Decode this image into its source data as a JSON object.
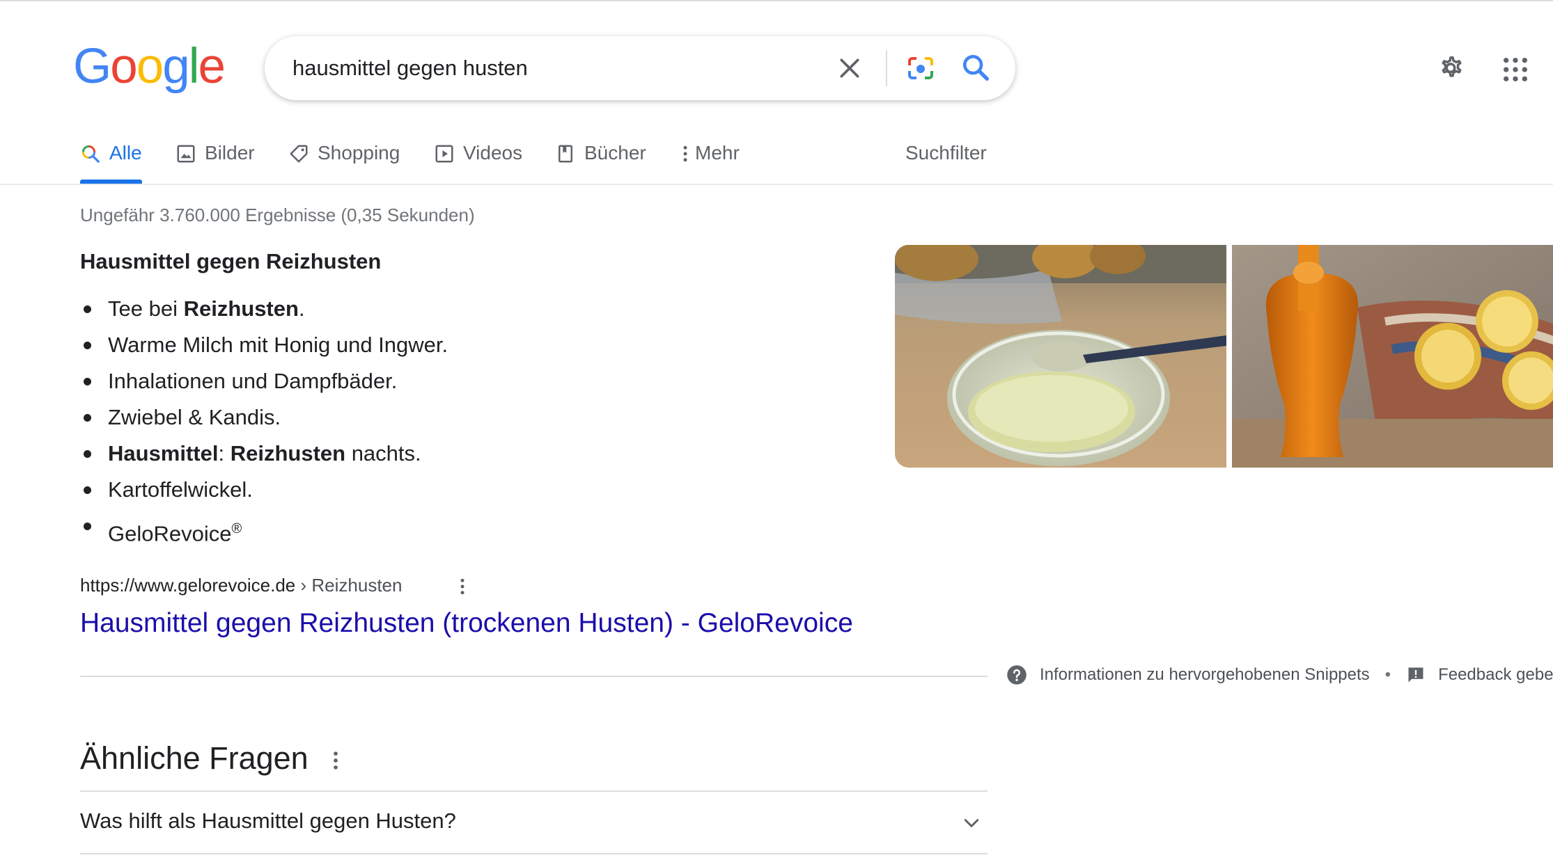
{
  "logo": {
    "letters": [
      "G",
      "o",
      "o",
      "g",
      "l",
      "e"
    ],
    "colors": [
      "#4285F4",
      "#EA4335",
      "#FBBC05",
      "#4285F4",
      "#34A853",
      "#EA4335"
    ]
  },
  "search": {
    "query": "hausmittel gegen husten"
  },
  "icons": {
    "clear": "close-icon",
    "camera": "lens-camera-icon",
    "search": "search-icon",
    "settings": "gear-icon",
    "apps": "apps-grid-icon"
  },
  "tabs": [
    {
      "label": "Alle",
      "icon": "search-icon",
      "active": true
    },
    {
      "label": "Bilder",
      "icon": "image-icon"
    },
    {
      "label": "Shopping",
      "icon": "tag-icon"
    },
    {
      "label": "Videos",
      "icon": "play-icon"
    },
    {
      "label": "Bücher",
      "icon": "book-icon"
    },
    {
      "label": "Mehr",
      "icon": "more-vert-icon"
    }
  ],
  "search_tools": "Suchfilter",
  "stats": "Ungefähr 3.760.000 Ergebnisse (0,35 Sekunden)",
  "snippet": {
    "title": "Hausmittel gegen Reizhusten",
    "items": [
      {
        "pre": "Tee bei ",
        "bold": "Reizhusten",
        "post": "."
      },
      {
        "text": "Warme Milch mit Honig und Ingwer."
      },
      {
        "text": "Inhalationen und Dampfbäder."
      },
      {
        "text": "Zwiebel & Kandis."
      },
      {
        "bold1": "Hausmittel",
        "sep": ": ",
        "bold2": "Reizhusten",
        "post": " nachts."
      },
      {
        "text": "Kartoffelwickel."
      },
      {
        "text": "GeloRevoice",
        "sup": "®"
      }
    ]
  },
  "result": {
    "url": "https://www.gelorevoice.de",
    "breadcrumb": " › Reizhusten",
    "title": "Hausmittel gegen Reizhusten (trockenen Husten) - GeloRevoice"
  },
  "snippet_footer": {
    "info": "Informationen zu hervorgehobenen Snippets",
    "dot": "•",
    "feedback": "Feedback geben"
  },
  "paa": {
    "title": "Ähnliche Fragen",
    "questions": [
      "Was hilft als Hausmittel gegen Husten?"
    ]
  }
}
